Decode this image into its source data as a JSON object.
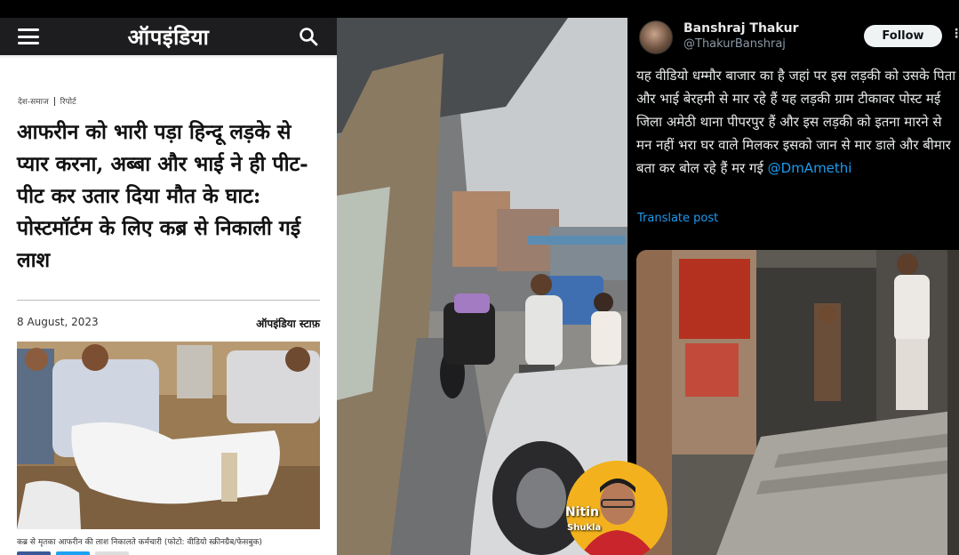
{
  "article": {
    "site_logo": "ऑपइंडिया",
    "category": "देश-समाज",
    "type": "रिपोर्ट",
    "headline": "आफरीन को भारी पड़ा हिन्दू लड़के से प्यार करना, अब्बा और भाई ने ही पीट-पीट कर उतार दिया मौत के घाट: पोस्टमॉर्टम के लिए कब्र से निकाली गई लाश",
    "date": "8 August, 2023",
    "author": "ऑपइंडिया स्टाफ़",
    "caption": "कब्र से मृतका आफरीन की लाश निकालते कर्मचारी (फोटो: वीडियो स्क्रीनग्रैब/फेसबुक)"
  },
  "tweet": {
    "display_name": "Banshraj Thakur",
    "handle": "@ThakurBanshraj",
    "follow_label": "Follow",
    "text": "यह वीडियो धम्मौर बाजार का है जहां पर इस लड़की को उसके पिता और भाई बेरहमी से मार रहे हैं यह लड़की ग्राम टीकावर पोस्ट  मई जिला अमेठी थाना पीपरपुर हैं और इस लड़की को इतना मारने से मन नहीं भरा घर वाले मिलकर इसको जान से मार डाले और बीमार बता कर बोल रहे हैं मर गई ",
    "mention": "@DmAmethi",
    "translate_label": "Translate post"
  },
  "watermark": {
    "first_name": "Nitin",
    "last_name": "Shukla"
  },
  "icons": {
    "menu": "hamburger-menu-icon",
    "search": "search-icon",
    "more": "more-options-icon"
  },
  "colors": {
    "logo_accent": "#f0702f",
    "link_blue": "#1d9bf0",
    "badge_yellow": "#f3b21d"
  }
}
